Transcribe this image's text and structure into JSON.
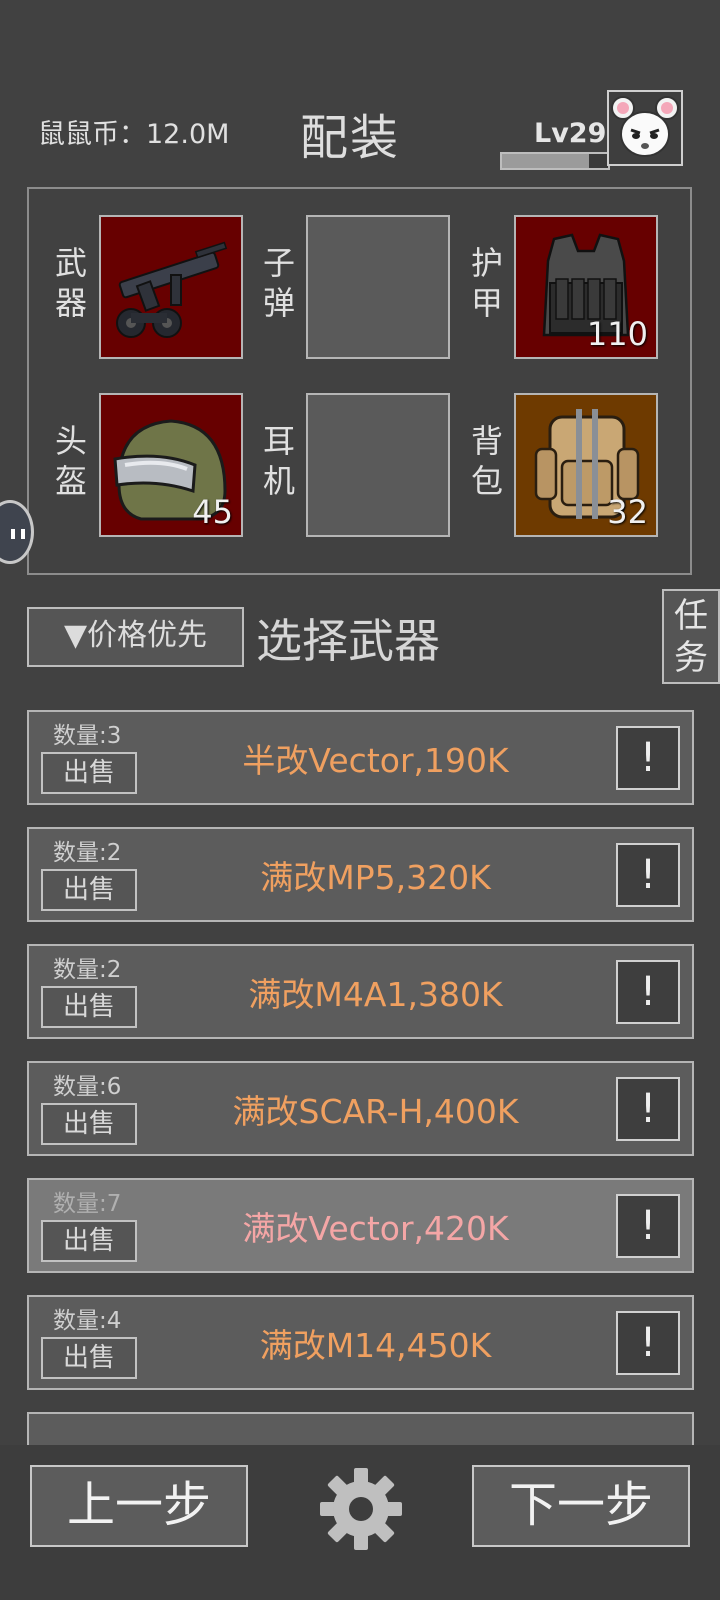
{
  "header": {
    "currency_label": "鼠鼠币：12.0M",
    "title": "配装",
    "level": "Lv29",
    "xp_progress": 0.82
  },
  "equipment": {
    "slots": [
      {
        "label": "武器",
        "count": ""
      },
      {
        "label": "子弹",
        "count": ""
      },
      {
        "label": "护甲",
        "count": "110"
      },
      {
        "label": "头盔",
        "count": "45"
      },
      {
        "label": "耳机",
        "count": ""
      },
      {
        "label": "背包",
        "count": "32"
      }
    ]
  },
  "sort_button": "▼价格优先",
  "list_heading": "选择武器",
  "task_button": "任务",
  "items": [
    {
      "qty": "数量:3",
      "sell": "出售",
      "name": "半改Vector,190K",
      "info": "!"
    },
    {
      "qty": "数量:2",
      "sell": "出售",
      "name": "满改MP5,320K",
      "info": "!"
    },
    {
      "qty": "数量:2",
      "sell": "出售",
      "name": "满改M4A1,380K",
      "info": "!"
    },
    {
      "qty": "数量:6",
      "sell": "出售",
      "name": "满改SCAR-H,400K",
      "info": "!"
    },
    {
      "qty": "数量:7",
      "sell": "出售",
      "name": "满改Vector,420K",
      "info": "!"
    },
    {
      "qty": "数量:4",
      "sell": "出售",
      "name": "满改M14,450K",
      "info": "!"
    }
  ],
  "footer": {
    "prev": "上一步",
    "next": "下一步"
  }
}
